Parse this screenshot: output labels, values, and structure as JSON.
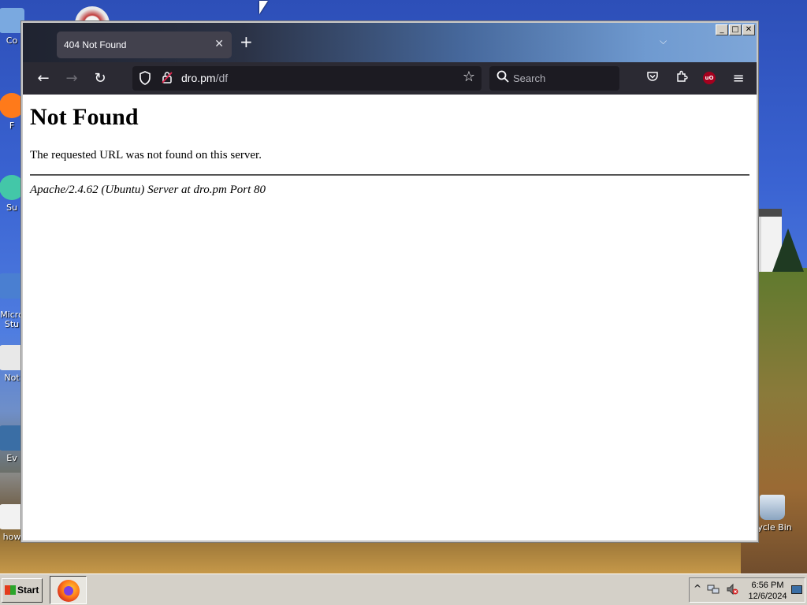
{
  "desktop": {
    "icons": [
      {
        "label": "Co"
      },
      {
        "label": "F"
      },
      {
        "label": "Su"
      },
      {
        "label": "Micro\nStu"
      },
      {
        "label": "Not"
      },
      {
        "label": "Ev"
      },
      {
        "label": "how"
      },
      {
        "label": "cycle Bin"
      }
    ]
  },
  "browser": {
    "tab": {
      "title": "404 Not Found",
      "close_glyph": "✕"
    },
    "new_tab_glyph": "+",
    "list_tabs_glyph": "⌵",
    "window_controls": {
      "minimize": "_",
      "maximize": "□",
      "close": "✕"
    },
    "nav": {
      "back": "←",
      "forward": "→",
      "reload": "↻"
    },
    "url": {
      "host": "dro.pm",
      "path": "/df"
    },
    "search": {
      "placeholder": "Search"
    },
    "toolbar": {
      "pocket": "♡",
      "extensions": "⧉",
      "ublock": "uO",
      "menu": "≡"
    }
  },
  "page": {
    "heading": "Not Found",
    "message": "The requested URL was not found on this server.",
    "address": "Apache/2.4.62 (Ubuntu) Server at dro.pm Port 80"
  },
  "taskbar": {
    "start_label": "Start",
    "tray": {
      "expand": "^",
      "clock_time": "6:56 PM",
      "clock_date": "12/6/2024"
    }
  }
}
